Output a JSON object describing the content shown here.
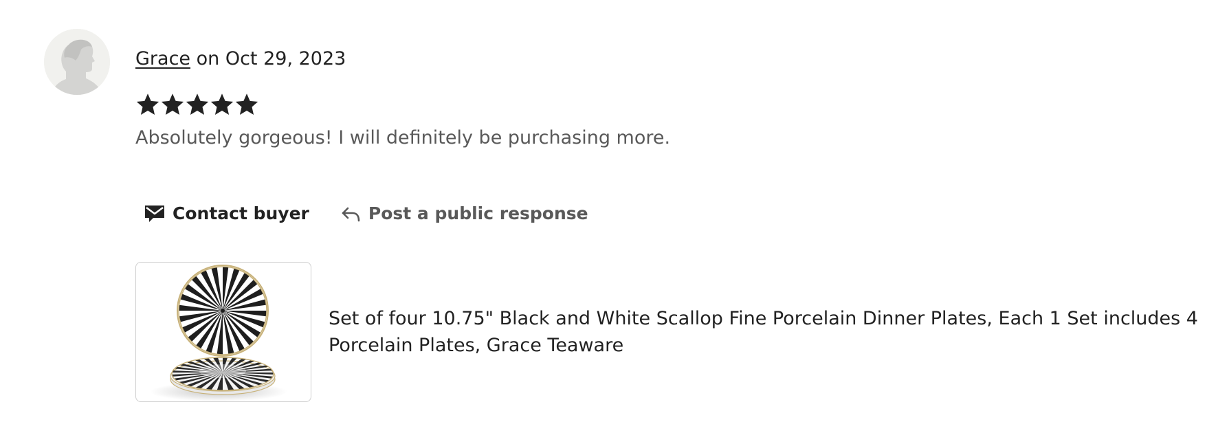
{
  "review": {
    "reviewer_name": "Grace",
    "date_text": " on Oct 29, 2023",
    "rating": 5,
    "rating_max": 5,
    "text": "Absolutely gorgeous! I will definitely be purchasing more."
  },
  "actions": {
    "contact_label": "Contact buyer",
    "respond_label": "Post a public response"
  },
  "product": {
    "title": "Set of four 10.75\" Black and White Scallop Fine Porcelain Dinner Plates, Each 1 Set includes 4 Porcelain Plates, Grace Teaware"
  },
  "icons": {
    "avatar": "default-avatar-silhouette",
    "star": "star-filled-icon",
    "contact": "envelope-icon",
    "respond": "reply-arrow-icon"
  },
  "colors": {
    "text_primary": "#222222",
    "text_secondary": "#595959",
    "star": "#222222",
    "thumb_border": "#cfcfcf"
  }
}
